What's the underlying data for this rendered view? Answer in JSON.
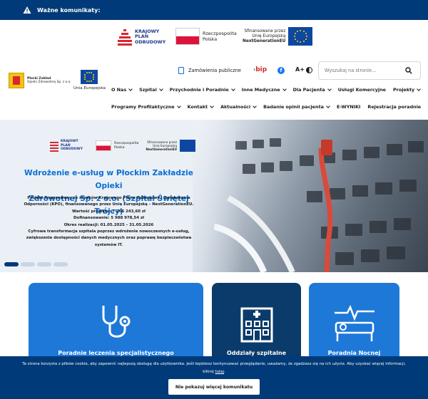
{
  "alert": {
    "label": "Ważne komunikaty:"
  },
  "funding": {
    "kpo": [
      "KRAJOWY",
      "PLAN",
      "ODBUDOWY"
    ],
    "poland": [
      "Rzeczpospolita",
      "Polska"
    ],
    "eu": [
      "Sfinansowane przez",
      "Unię Europejską",
      "NextGenerationEU"
    ]
  },
  "header": {
    "logo_lines": [
      "Płocki Zakład",
      "Opieki Zdrowotnej Sp. z o.o."
    ],
    "eu_label": "Unia Europejska",
    "orders_link": "Zamówienia publiczne",
    "bip": "bip",
    "font_size": "A+",
    "search_placeholder": "Wyszukaj na stronie..."
  },
  "nav": {
    "row1": [
      {
        "label": "O Nas",
        "dropdown": true
      },
      {
        "label": "Szpital",
        "dropdown": true
      },
      {
        "label": "Przychodnie i Poradnie",
        "dropdown": true
      },
      {
        "label": "Inne Medyczne",
        "dropdown": true
      },
      {
        "label": "Dla Pacjenta",
        "dropdown": true
      },
      {
        "label": "Usługi Komercyjne",
        "dropdown": false
      },
      {
        "label": "Projekty",
        "dropdown": true
      }
    ],
    "row2": [
      {
        "label": "Programy Profilaktyczne",
        "dropdown": true
      },
      {
        "label": "Kontakt",
        "dropdown": true
      },
      {
        "label": "Aktualności",
        "dropdown": true
      },
      {
        "label": "Badanie opinii pacjenta",
        "dropdown": true
      },
      {
        "label": "E-WYNIKI",
        "dropdown": false
      },
      {
        "label": "Rejestracja poradnie",
        "dropdown": false
      }
    ]
  },
  "hero": {
    "logos": {
      "kpo": [
        "KRAJOWY",
        "PLAN",
        "ODBUDOWY"
      ],
      "poland": [
        "Rzeczpospolita",
        "Polska"
      ],
      "eu": [
        "Sfinansowane przez",
        "Unię Europejską",
        "NextGenerationEU"
      ]
    },
    "title_lines": [
      "Wdrożenie e-usług w Płockim Zakładzie Opieki",
      "Zdrowotnej Sp. z o.o. (Szpital Świętej Trójcy)"
    ],
    "body": [
      "Projekt finansowany ze środków Krajowego Planu Odbudowy i Zwiększania",
      "Odporności (KPO), finansowanego przez Unię Europejską – NextGenerationEU.",
      "Wartość projektu: 7 266 243,60 zł",
      "Dofinansowanie: 5 988 978,54 zł",
      "Okres realizacji: 01.05.2025 – 31.05.2026",
      "Cyfrowa transformacja szpitala poprzez wdrożenie nowoczesnych e-usług,",
      "zwiększenie dostępności danych medycznych oraz poprawę bezpieczeństwa",
      "systemów IT."
    ],
    "slides": 4,
    "active_slide": 1
  },
  "cards": [
    {
      "title": "Poradnie leczenia specjalistycznego",
      "icon": "stethoscope-icon"
    },
    {
      "title": "Oddziały szpitalne",
      "icon": "hospital-icon"
    },
    {
      "title": "Poradnia Nocnej",
      "icon": "hospital-bed-icon"
    }
  ],
  "cookie": {
    "message_1": "Ta strona korzysta z plików cookie, aby zapewnić najlepszą obsługę dla użytkownika. Jeśli będziesz kontynuować przeglądanie, uważamy, że zgadzasz się na ich użycie. Aby uzyskać więcej informacji,",
    "message_2": "kliknij",
    "link": "tutaj",
    "button": "Nie pokazuj więcej komunikatu"
  },
  "colors": {
    "primary": "#003a78",
    "accent": "#1e78d8",
    "link": "#0b6ed2",
    "dark_card": "#0b3b6b"
  }
}
